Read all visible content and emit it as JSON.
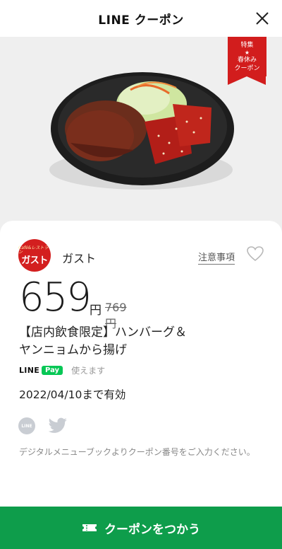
{
  "header": {
    "title": "LINE クーポン",
    "close_icon": "close-icon"
  },
  "ribbon": {
    "line1": "特集",
    "star": "★",
    "line2": "春休み",
    "line3": "クーポン"
  },
  "store": {
    "logo_small": "Café&レストラン",
    "logo_big": "ガスト",
    "name": "ガスト",
    "notes_link": "注意事項",
    "favorite_icon": "heart-icon"
  },
  "price": {
    "current": "659",
    "unit": "円",
    "original": "769円"
  },
  "product": {
    "line1": "【店内飲食限定】ハンバーグ＆",
    "line2": "ヤンニョムから揚げ"
  },
  "payment": {
    "line_label": "LINE",
    "pay_label": "Pay",
    "note": "使えます"
  },
  "validity": "2022/04/10まで有効",
  "share": {
    "line_label": "LINE",
    "icons": [
      "line-share-icon",
      "twitter-icon"
    ]
  },
  "note": "デジタルメニューブックよりクーポン番号をご入力ください。",
  "cta": {
    "label": "クーポンをつかう",
    "icon": "ticket-icon"
  },
  "colors": {
    "accent": "#0e9d4b",
    "brand_red": "#d31f1f",
    "ribbon": "#d21d1d",
    "line_green": "#06c755"
  }
}
